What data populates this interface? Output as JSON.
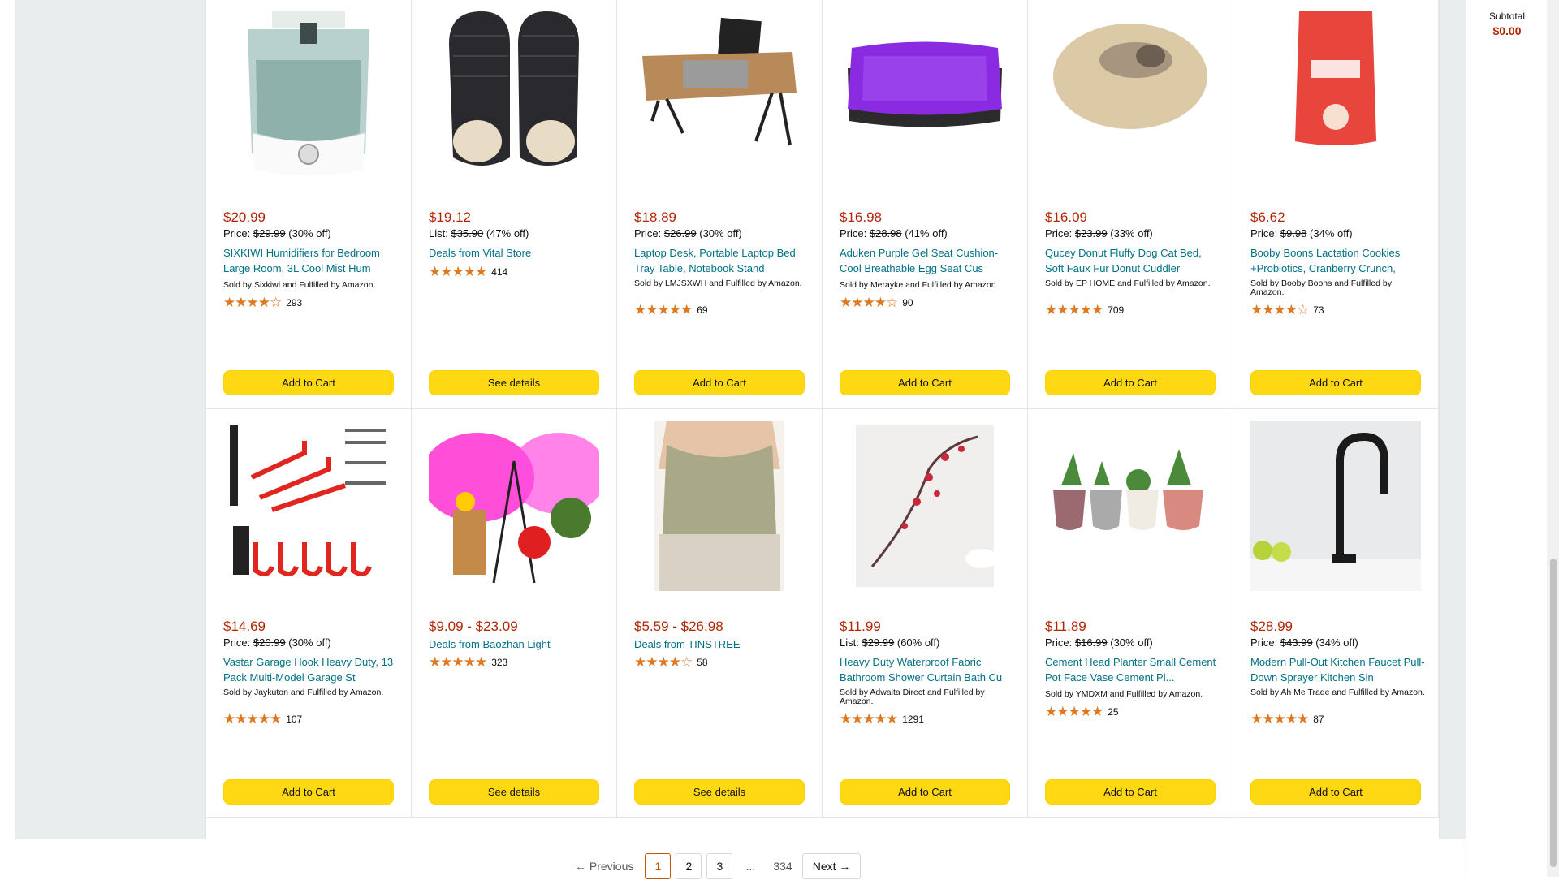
{
  "subtotal": {
    "label": "Subtotal",
    "value": "$0.00"
  },
  "row1": [
    {
      "price": "$20.99",
      "old_prefix": "Price:",
      "old_price": "$29.99",
      "off": "(30% off)",
      "title": "SIXKIWI Humidifiers for Bedroom Large Room, 3L Cool Mist Hum",
      "seller": "Sold by Sixkiwi and Fulfilled by Amazon.",
      "stars": "★★★★☆",
      "reviews": "293",
      "button": "Add to Cart"
    },
    {
      "price": "$19.12",
      "old_prefix": "List:",
      "old_price": "$35.90",
      "off": "(47% off)",
      "title": "Deals from Vital Store",
      "seller": "",
      "stars": "★★★★★",
      "reviews": "414",
      "button": "See details"
    },
    {
      "price": "$18.89",
      "old_prefix": "Price:",
      "old_price": "$26.99",
      "off": "(30% off)",
      "title": "Laptop Desk, Portable Laptop Bed Tray Table, Notebook Stand",
      "seller": "Sold by LMJSXWH and Fulfilled by Amazon.",
      "stars": "★★★★★",
      "reviews": "69",
      "button": "Add to Cart"
    },
    {
      "price": "$16.98",
      "old_prefix": "Price:",
      "old_price": "$28.98",
      "off": "(41% off)",
      "title": "Aduken Purple Gel Seat Cushion- Cool Breathable Egg Seat Cus",
      "seller": "Sold by Merayke and Fulfilled by Amazon.",
      "stars": "★★★★☆",
      "reviews": "90",
      "button": "Add to Cart"
    },
    {
      "price": "$16.09",
      "old_prefix": "Price:",
      "old_price": "$23.99",
      "off": "(33% off)",
      "title": "Qucey Donut Fluffy Dog Cat Bed, Soft Faux Fur Donut Cuddler",
      "seller": "Sold by EP HOME and Fulfilled by Amazon.",
      "stars": "★★★★★",
      "reviews": "709",
      "button": "Add to Cart"
    },
    {
      "price": "$6.62",
      "old_prefix": "Price:",
      "old_price": "$9.98",
      "off": "(34% off)",
      "title": "Booby Boons Lactation Cookies +Probiotics, Cranberry Crunch,",
      "seller": "Sold by Booby Boons and Fulfilled by Amazon.",
      "stars": "★★★★☆",
      "reviews": "73",
      "button": "Add to Cart"
    }
  ],
  "row2": [
    {
      "price": "$14.69",
      "old_prefix": "Price:",
      "old_price": "$20.99",
      "off": "(30% off)",
      "title": "Vastar Garage Hook Heavy Duty, 13 Pack Multi-Model Garage St",
      "seller": "Sold by Jaykuton and Fulfilled by Amazon.",
      "stars": "★★★★★",
      "reviews": "107",
      "button": "Add to Cart"
    },
    {
      "price": "$9.09 - $23.09",
      "old_prefix": "",
      "old_price": "",
      "off": "",
      "title": "Deals from Baozhan Light",
      "seller": "",
      "stars": "★★★★★",
      "reviews": "323",
      "button": "See details"
    },
    {
      "price": "$5.59 - $26.98",
      "old_prefix": "",
      "old_price": "",
      "off": "",
      "title": "Deals from TINSTREE",
      "seller": "",
      "stars": "★★★★☆",
      "reviews": "58",
      "button": "See details"
    },
    {
      "price": "$11.99",
      "old_prefix": "List:",
      "old_price": "$29.99",
      "off": "(60% off)",
      "title": "Heavy Duty Waterproof Fabric Bathroom Shower Curtain Bath Cu",
      "seller": "Sold by Adwaita Direct and Fulfilled by Amazon.",
      "stars": "★★★★★",
      "reviews": "1291",
      "button": "Add to Cart"
    },
    {
      "price": "$11.89",
      "old_prefix": "Price:",
      "old_price": "$16.99",
      "off": "(30% off)",
      "title": "Cement Head Planter Small Cement Pot Face Vase Cement Pl...",
      "seller": "Sold by YMDXM and Fulfilled by Amazon.",
      "stars": "★★★★★",
      "reviews": "25",
      "button": "Add to Cart"
    },
    {
      "price": "$28.99",
      "old_prefix": "Price:",
      "old_price": "$43.99",
      "off": "(34% off)",
      "title": "Modern Pull-Out Kitchen Faucet Pull-Down Sprayer Kitchen Sin",
      "seller": "Sold by Ah Me Trade and Fulfilled by Amazon.",
      "stars": "★★★★★",
      "reviews": "87",
      "button": "Add to Cart"
    }
  ],
  "pagination": {
    "previous": "← Previous",
    "pages": [
      "1",
      "2",
      "3"
    ],
    "ellipsis": "...",
    "last": "334",
    "next": "Next →"
  },
  "colors": {
    "price": "#b12704",
    "link": "#007185",
    "button": "#ffd814",
    "stars": "#de7921"
  }
}
